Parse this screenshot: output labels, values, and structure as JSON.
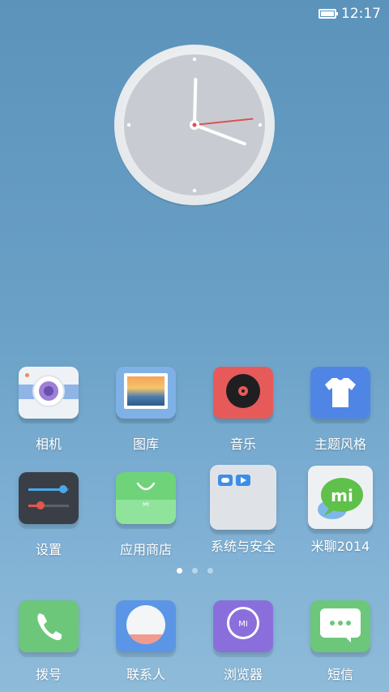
{
  "status": {
    "time": "12:17",
    "battery_icon": "battery-full-icon"
  },
  "clock": {
    "hour": 12,
    "minute": 17,
    "second": 14
  },
  "apps_row1": [
    {
      "label": "相机",
      "icon": "camera-icon"
    },
    {
      "label": "图库",
      "icon": "gallery-icon"
    },
    {
      "label": "音乐",
      "icon": "music-icon"
    },
    {
      "label": "主题风格",
      "icon": "theme-icon"
    }
  ],
  "apps_row2": [
    {
      "label": "设置",
      "icon": "settings-icon"
    },
    {
      "label": "应用商店",
      "icon": "app-store-icon"
    },
    {
      "label": "系统与安全",
      "icon": "folder-icon"
    },
    {
      "label": "米聊2014",
      "icon": "mitalk-icon"
    }
  ],
  "page_indicator": {
    "count": 3,
    "active": 0
  },
  "dock": [
    {
      "label": "拨号",
      "icon": "phone-icon"
    },
    {
      "label": "联系人",
      "icon": "contacts-icon"
    },
    {
      "label": "浏览器",
      "icon": "browser-icon"
    },
    {
      "label": "短信",
      "icon": "messages-icon"
    }
  ],
  "colors": {
    "camera": "#e9eef4",
    "gallery": "#7fb1e6",
    "music": "#e75a5a",
    "theme": "#4f86e6",
    "settings": "#3a3f47",
    "store": "#6fd37a",
    "folder": "#dfe3e8",
    "mitalk": "#e9edf0",
    "phone": "#6cc77a",
    "contacts": "#5b95e6",
    "browser": "#8a6fdc",
    "messages": "#6cc77a"
  }
}
